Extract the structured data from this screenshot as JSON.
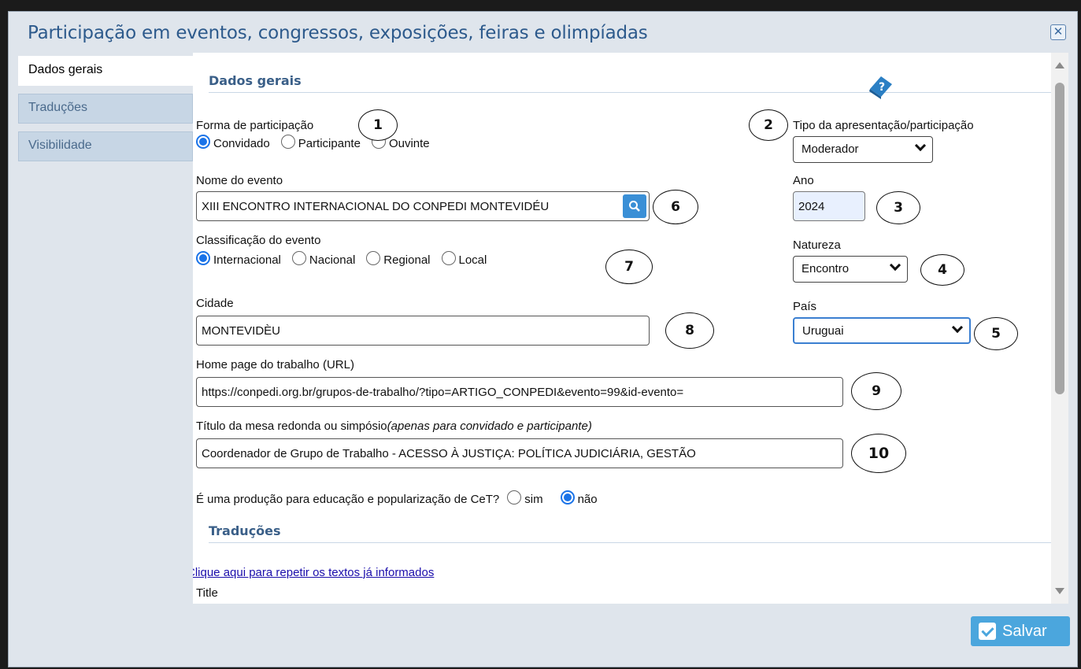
{
  "dialog": {
    "title": "Participação em eventos, congressos, exposições, feiras e olimpíadas",
    "close_icon": "close-icon"
  },
  "tabs": [
    {
      "label": "Dados gerais",
      "active": true
    },
    {
      "label": "Traduções",
      "active": false
    },
    {
      "label": "Visibilidade",
      "active": false
    }
  ],
  "sections": {
    "dados_gerais": "Dados gerais",
    "traducoes": "Traduções"
  },
  "form": {
    "forma": {
      "label": "Forma de participação",
      "options": [
        "Convidado",
        "Participante",
        "Ouvinte"
      ],
      "selected": "Convidado"
    },
    "tipo": {
      "label": "Tipo da apresentação/participação",
      "value": "Moderador"
    },
    "nome_evento": {
      "label": "Nome do evento",
      "value": "XIII ENCONTRO INTERNACIONAL DO CONPEDI MONTEVIDÉU"
    },
    "ano": {
      "label": "Ano",
      "value": "2024"
    },
    "classificacao": {
      "label": "Classificação do evento",
      "options": [
        "Internacional",
        "Nacional",
        "Regional",
        "Local"
      ],
      "selected": "Internacional"
    },
    "natureza": {
      "label": "Natureza",
      "value": "Encontro"
    },
    "cidade": {
      "label": "Cidade",
      "value": "MONTEVIDÈU"
    },
    "pais": {
      "label": "País",
      "value": "Uruguai"
    },
    "home_page": {
      "label": "Home page do trabalho (URL)",
      "value": "https://conpedi.org.br/grupos-de-trabalho/?tipo=ARTIGO_CONPEDI&evento=99&id-evento="
    },
    "titulo_mesa": {
      "label": "Título da mesa redonda ou simpósio",
      "hint": "(apenas para convidado e participante)",
      "value": "Coordenador de Grupo de Trabalho - ACESSO À JUSTIÇA: POLÍTICA JUDICIÁRIA, GESTÃO"
    },
    "educacao": {
      "label": "É uma produção para educação e popularização de CeT?",
      "options": [
        "sim",
        "não"
      ],
      "selected": "não"
    }
  },
  "traducoes": {
    "repeat_link": "Clique aqui para repetir os textos já informados",
    "title_label": "Title"
  },
  "annotations": [
    "1",
    "2",
    "3",
    "4",
    "5",
    "6",
    "7",
    "8",
    "9",
    "10"
  ],
  "save_label": "Salvar",
  "colors": {
    "accent": "#3a8fd6",
    "title": "#2d5a8c",
    "radio_selected": "#1a73e8"
  }
}
